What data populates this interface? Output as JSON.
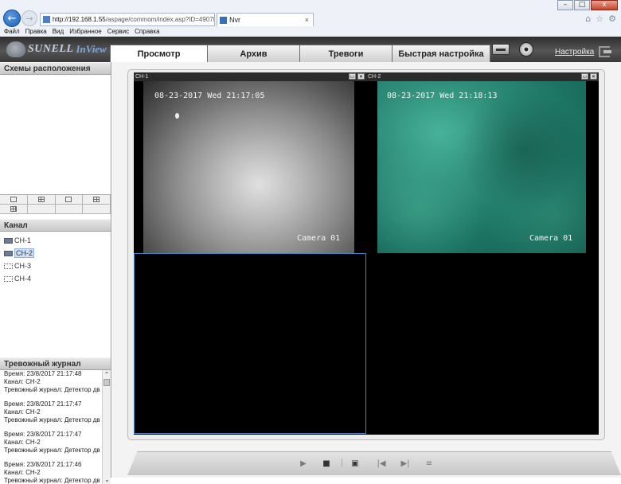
{
  "browser": {
    "url_host": "http://192.168.1.55",
    "url_path": "/aspage/commom/index.asp?ID=4907f",
    "url_tools": "▾ C",
    "tab_title": "Nvr",
    "tab_close": "×",
    "window_controls": [
      "–",
      "□",
      "x"
    ],
    "menu": [
      "Файл",
      "Правка",
      "Вид",
      "Избранное",
      "Сервис",
      "Справка"
    ],
    "right_icons": [
      "home-icon",
      "star-icon",
      "gear-icon"
    ]
  },
  "app": {
    "logo_brand": "SUNELL",
    "logo_product": "InView",
    "tabs": [
      "Просмотр",
      "Архив",
      "Тревоги",
      "Быстрая настройка"
    ],
    "active_tab": 0,
    "settings_label": "Настройка"
  },
  "left": {
    "layouts_title": "Схемы расположения",
    "channel_title": "Канал",
    "channels": [
      {
        "label": "CH-1",
        "state": "active"
      },
      {
        "label": "CH-2",
        "state": "active",
        "selected": true
      },
      {
        "label": "CH-3",
        "state": "inactive"
      },
      {
        "label": "CH-4",
        "state": "inactive"
      }
    ],
    "alarm_title": "Тревожный журнал",
    "alarm_entries": [
      {
        "time": "Время: 23/8/2017 21:17:48",
        "channel": "Канал: CH-2",
        "text": "Тревожный журнал: Детектор дв"
      },
      {
        "time": "Время: 23/8/2017 21:17:47",
        "channel": "Канал: CH-2",
        "text": "Тревожный журнал: Детектор дв"
      },
      {
        "time": "Время: 23/8/2017 21:17:47",
        "channel": "Канал: CH-2",
        "text": "Тревожный журнал: Детектор дв"
      },
      {
        "time": "Время: 23/8/2017 21:17:46",
        "channel": "Канал: CH-2",
        "text": "Тревожный журнал: Детектор дв"
      }
    ]
  },
  "video": {
    "ch1": {
      "label": "CH-1",
      "timestamp": "08-23-2017 Wed 21:17:05",
      "camera": "Camera 01"
    },
    "ch2": {
      "label": "CH-2",
      "timestamp": "08-23-2017 Wed 21:18:13",
      "camera": "Camera 01"
    },
    "selected_cell": 3
  },
  "controls": {
    "play": "▶",
    "stop": "■",
    "save": "▣",
    "prev": "|◀",
    "next": "▶|",
    "menu": "≡"
  },
  "colors": {
    "accent": "#3b86c6",
    "cam2_tint": "#2f8f7b"
  }
}
